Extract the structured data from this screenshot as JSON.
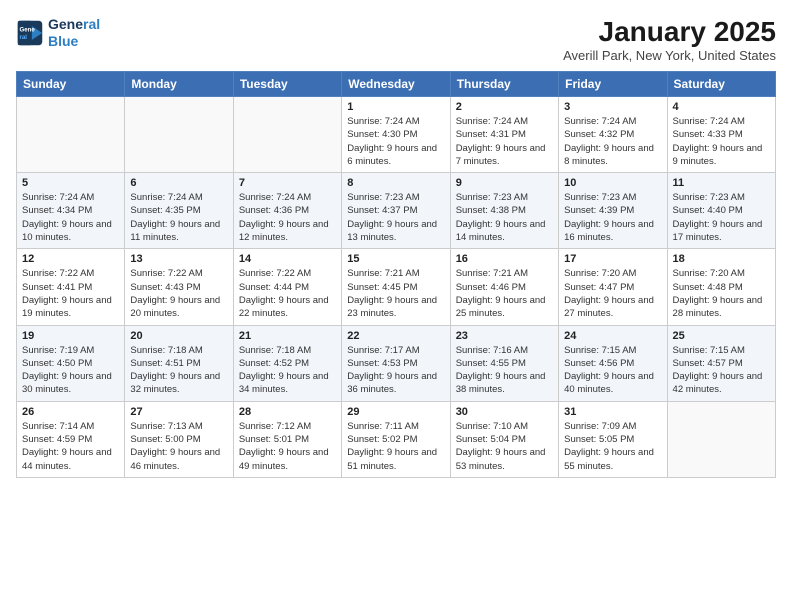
{
  "logo": {
    "line1": "General",
    "line2": "Blue"
  },
  "title": "January 2025",
  "location": "Averill Park, New York, United States",
  "days_of_week": [
    "Sunday",
    "Monday",
    "Tuesday",
    "Wednesday",
    "Thursday",
    "Friday",
    "Saturday"
  ],
  "weeks": [
    [
      {
        "day": "",
        "info": ""
      },
      {
        "day": "",
        "info": ""
      },
      {
        "day": "",
        "info": ""
      },
      {
        "day": "1",
        "info": "Sunrise: 7:24 AM\nSunset: 4:30 PM\nDaylight: 9 hours and 6 minutes."
      },
      {
        "day": "2",
        "info": "Sunrise: 7:24 AM\nSunset: 4:31 PM\nDaylight: 9 hours and 7 minutes."
      },
      {
        "day": "3",
        "info": "Sunrise: 7:24 AM\nSunset: 4:32 PM\nDaylight: 9 hours and 8 minutes."
      },
      {
        "day": "4",
        "info": "Sunrise: 7:24 AM\nSunset: 4:33 PM\nDaylight: 9 hours and 9 minutes."
      }
    ],
    [
      {
        "day": "5",
        "info": "Sunrise: 7:24 AM\nSunset: 4:34 PM\nDaylight: 9 hours and 10 minutes."
      },
      {
        "day": "6",
        "info": "Sunrise: 7:24 AM\nSunset: 4:35 PM\nDaylight: 9 hours and 11 minutes."
      },
      {
        "day": "7",
        "info": "Sunrise: 7:24 AM\nSunset: 4:36 PM\nDaylight: 9 hours and 12 minutes."
      },
      {
        "day": "8",
        "info": "Sunrise: 7:23 AM\nSunset: 4:37 PM\nDaylight: 9 hours and 13 minutes."
      },
      {
        "day": "9",
        "info": "Sunrise: 7:23 AM\nSunset: 4:38 PM\nDaylight: 9 hours and 14 minutes."
      },
      {
        "day": "10",
        "info": "Sunrise: 7:23 AM\nSunset: 4:39 PM\nDaylight: 9 hours and 16 minutes."
      },
      {
        "day": "11",
        "info": "Sunrise: 7:23 AM\nSunset: 4:40 PM\nDaylight: 9 hours and 17 minutes."
      }
    ],
    [
      {
        "day": "12",
        "info": "Sunrise: 7:22 AM\nSunset: 4:41 PM\nDaylight: 9 hours and 19 minutes."
      },
      {
        "day": "13",
        "info": "Sunrise: 7:22 AM\nSunset: 4:43 PM\nDaylight: 9 hours and 20 minutes."
      },
      {
        "day": "14",
        "info": "Sunrise: 7:22 AM\nSunset: 4:44 PM\nDaylight: 9 hours and 22 minutes."
      },
      {
        "day": "15",
        "info": "Sunrise: 7:21 AM\nSunset: 4:45 PM\nDaylight: 9 hours and 23 minutes."
      },
      {
        "day": "16",
        "info": "Sunrise: 7:21 AM\nSunset: 4:46 PM\nDaylight: 9 hours and 25 minutes."
      },
      {
        "day": "17",
        "info": "Sunrise: 7:20 AM\nSunset: 4:47 PM\nDaylight: 9 hours and 27 minutes."
      },
      {
        "day": "18",
        "info": "Sunrise: 7:20 AM\nSunset: 4:48 PM\nDaylight: 9 hours and 28 minutes."
      }
    ],
    [
      {
        "day": "19",
        "info": "Sunrise: 7:19 AM\nSunset: 4:50 PM\nDaylight: 9 hours and 30 minutes."
      },
      {
        "day": "20",
        "info": "Sunrise: 7:18 AM\nSunset: 4:51 PM\nDaylight: 9 hours and 32 minutes."
      },
      {
        "day": "21",
        "info": "Sunrise: 7:18 AM\nSunset: 4:52 PM\nDaylight: 9 hours and 34 minutes."
      },
      {
        "day": "22",
        "info": "Sunrise: 7:17 AM\nSunset: 4:53 PM\nDaylight: 9 hours and 36 minutes."
      },
      {
        "day": "23",
        "info": "Sunrise: 7:16 AM\nSunset: 4:55 PM\nDaylight: 9 hours and 38 minutes."
      },
      {
        "day": "24",
        "info": "Sunrise: 7:15 AM\nSunset: 4:56 PM\nDaylight: 9 hours and 40 minutes."
      },
      {
        "day": "25",
        "info": "Sunrise: 7:15 AM\nSunset: 4:57 PM\nDaylight: 9 hours and 42 minutes."
      }
    ],
    [
      {
        "day": "26",
        "info": "Sunrise: 7:14 AM\nSunset: 4:59 PM\nDaylight: 9 hours and 44 minutes."
      },
      {
        "day": "27",
        "info": "Sunrise: 7:13 AM\nSunset: 5:00 PM\nDaylight: 9 hours and 46 minutes."
      },
      {
        "day": "28",
        "info": "Sunrise: 7:12 AM\nSunset: 5:01 PM\nDaylight: 9 hours and 49 minutes."
      },
      {
        "day": "29",
        "info": "Sunrise: 7:11 AM\nSunset: 5:02 PM\nDaylight: 9 hours and 51 minutes."
      },
      {
        "day": "30",
        "info": "Sunrise: 7:10 AM\nSunset: 5:04 PM\nDaylight: 9 hours and 53 minutes."
      },
      {
        "day": "31",
        "info": "Sunrise: 7:09 AM\nSunset: 5:05 PM\nDaylight: 9 hours and 55 minutes."
      },
      {
        "day": "",
        "info": ""
      }
    ]
  ]
}
